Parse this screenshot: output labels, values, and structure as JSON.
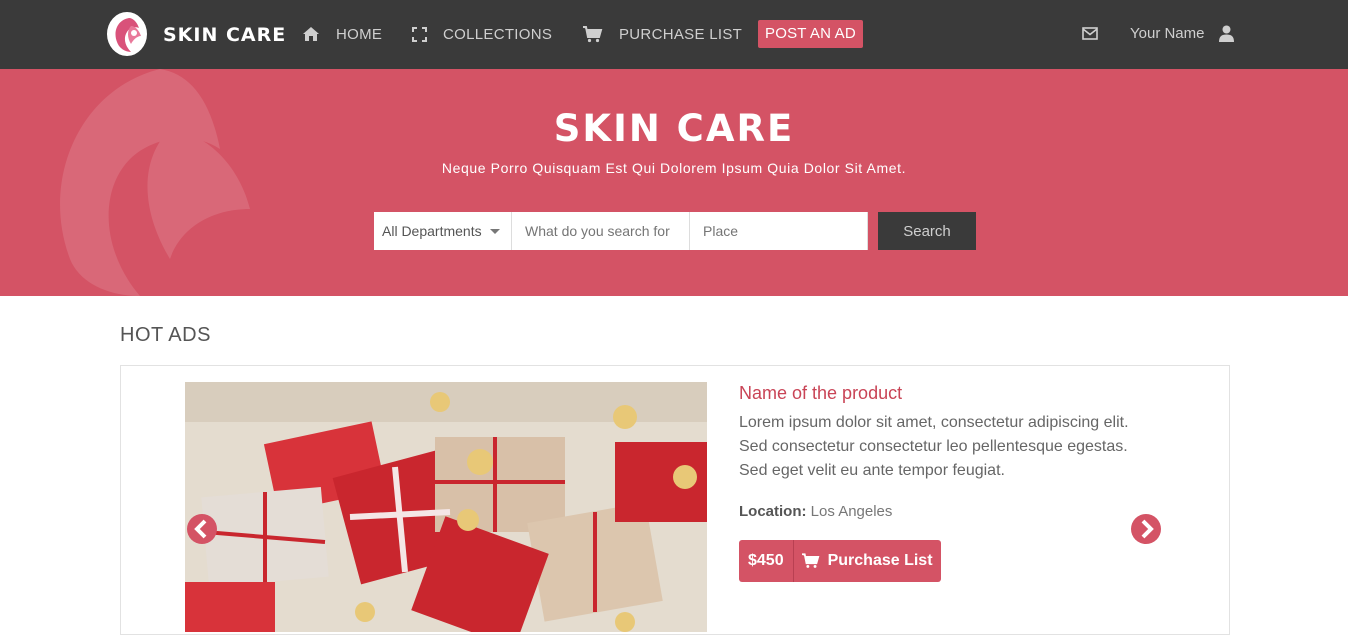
{
  "brand": {
    "name": "SKIN CARE"
  },
  "nav": {
    "home": "HOME",
    "collections": "COLLECTIONS",
    "purchase_list": "PURCHASE LIST",
    "post_ad": "POST AN AD",
    "user_name": "Your Name"
  },
  "hero": {
    "title": "SKIN CARE",
    "subtitle": "Neque Porro Quisquam Est Qui Dolorem Ipsum Quia Dolor Sit Amet."
  },
  "search": {
    "department": "All Departments",
    "what_placeholder": "What do you search for",
    "place_placeholder": "Place",
    "button": "Search"
  },
  "hot_ads": {
    "title": "HOT ADS",
    "product": {
      "name": "Name of the product",
      "description": "Lorem ipsum dolor sit amet, consectetur adipiscing elit. Sed consectetur consectetur leo pellentesque egestas. Sed eget velit eu ante tempor feugiat.",
      "location_label": "Location:",
      "location": "Los Angeles",
      "price": "$450",
      "purchase_label": "Purchase List"
    }
  },
  "colors": {
    "accent": "#d45365",
    "navbar": "#3a3a3a"
  },
  "icons": {
    "home": "home-icon",
    "collections": "expand-icon",
    "purchase": "cart-icon",
    "mail": "envelope-icon",
    "user": "user-icon"
  }
}
